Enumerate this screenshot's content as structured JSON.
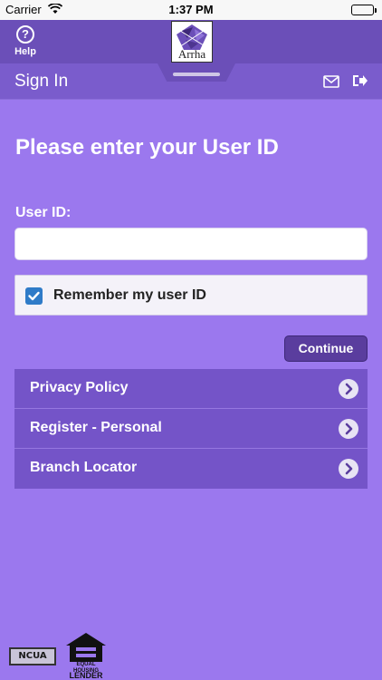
{
  "status_bar": {
    "carrier": "Carrier",
    "time": "1:37 PM"
  },
  "app_bar": {
    "help_label": "Help",
    "help_glyph": "?",
    "logo_text": "Arrha"
  },
  "signin_bar": {
    "title": "Sign In"
  },
  "main": {
    "heading": "Please enter your User ID",
    "user_id_label": "User ID:",
    "user_id_value": "",
    "user_id_placeholder": "",
    "remember_label": "Remember my user ID",
    "remember_checked": true,
    "continue_label": "Continue"
  },
  "links": [
    {
      "label": "Privacy Policy"
    },
    {
      "label": "Register - Personal"
    },
    {
      "label": "Branch Locator"
    }
  ],
  "footer": {
    "ncua_label": "NCUA",
    "ehl_line1": "EQUAL HOUSING",
    "ehl_line2": "LENDER"
  },
  "colors": {
    "background": "#9b78ee",
    "app_bar": "#6b4fb8",
    "link_row": "#7454c8",
    "checkbox": "#2f7bc8",
    "continue_button": "#5a3d9e"
  }
}
